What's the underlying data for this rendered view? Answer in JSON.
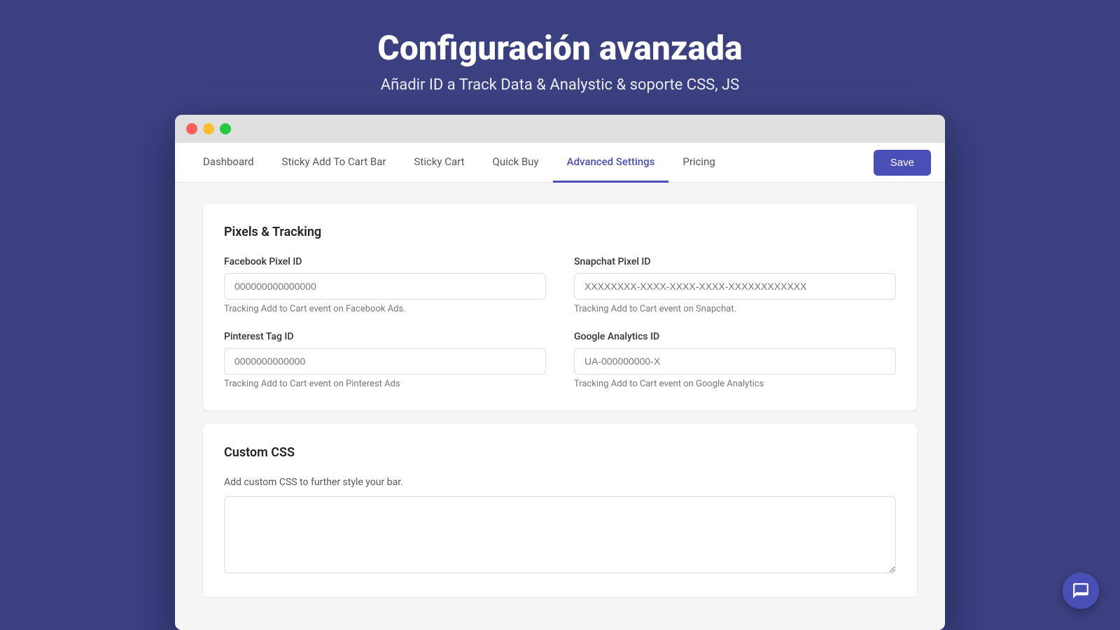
{
  "header": {
    "title": "Configuración avanzada",
    "subtitle": "Añadir ID a Track Data & Analystic & soporte CSS, JS"
  },
  "nav": {
    "tabs": [
      {
        "id": "dashboard",
        "label": "Dashboard",
        "active": false
      },
      {
        "id": "sticky-add-to-cart-bar",
        "label": "Sticky Add To Cart Bar",
        "active": false
      },
      {
        "id": "sticky-cart",
        "label": "Sticky Cart",
        "active": false
      },
      {
        "id": "quick-buy",
        "label": "Quick Buy",
        "active": false
      },
      {
        "id": "advanced-settings",
        "label": "Advanced Settings",
        "active": true
      },
      {
        "id": "pricing",
        "label": "Pricing",
        "active": false
      }
    ],
    "save_button": "Save"
  },
  "pixels_section": {
    "title": "Pixels & Tracking",
    "fields": [
      {
        "id": "facebook-pixel-id",
        "label": "Facebook Pixel ID",
        "placeholder": "000000000000000",
        "hint": "Tracking Add to Cart event on Facebook Ads."
      },
      {
        "id": "snapchat-pixel-id",
        "label": "Snapchat Pixel ID",
        "placeholder": "XXXXXXXX-XXXX-XXXX-XXXX-XXXXXXXXXXXX",
        "hint": "Tracking Add to Cart event on Snapchat."
      },
      {
        "id": "pinterest-tag-id",
        "label": "Pinterest Tag ID",
        "placeholder": "0000000000000",
        "hint": "Tracking Add to Cart event on Pinterest Ads"
      },
      {
        "id": "google-analytics-id",
        "label": "Google Analytics ID",
        "placeholder": "UA-000000000-X",
        "hint": "Tracking Add to Cart event on Google Analytics"
      }
    ]
  },
  "custom_css_section": {
    "title": "Custom CSS",
    "description": "Add custom CSS to further style your bar.",
    "placeholder": ""
  },
  "window_buttons": {
    "close": "close",
    "minimize": "minimize",
    "maximize": "maximize"
  }
}
